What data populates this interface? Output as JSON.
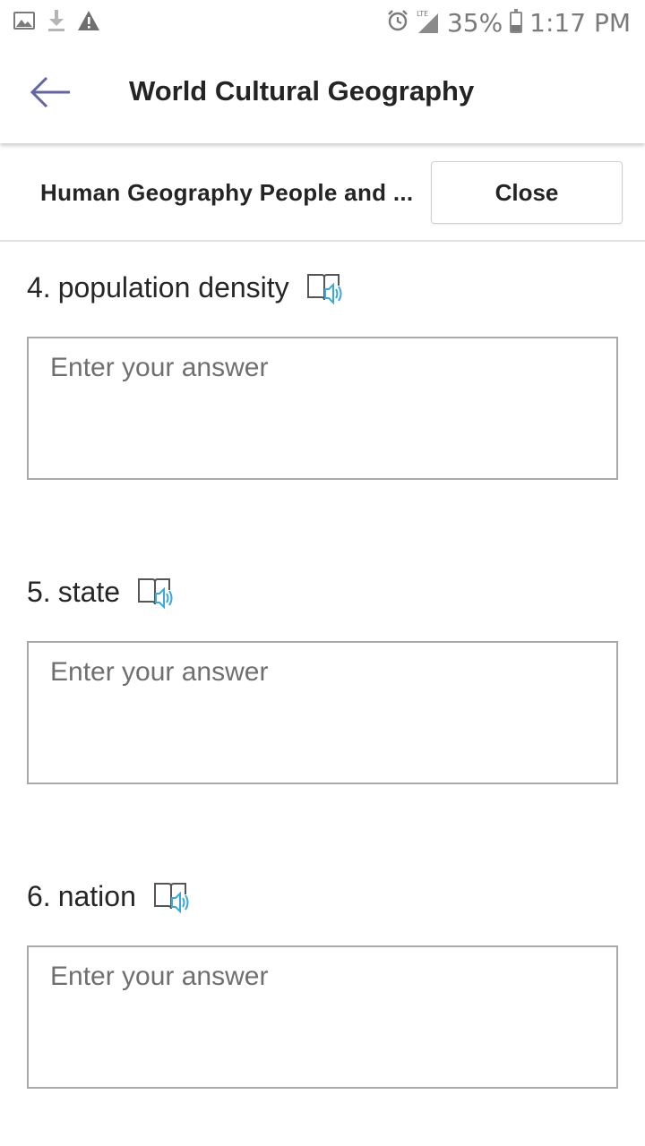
{
  "status_bar": {
    "battery": "35%",
    "battery_level": 0.35,
    "time": "1:17 PM",
    "network": "LTE",
    "icons_left": [
      "image-icon",
      "download-icon",
      "warning-icon"
    ],
    "icons_right": [
      "alarm-icon",
      "signal-icon",
      "battery-icon"
    ]
  },
  "app_bar": {
    "title": "World Cultural Geography",
    "back_icon": "back-arrow-icon",
    "accent_color": "#6264a7"
  },
  "sub_header": {
    "form_name": "Human Geography People and ...",
    "close_label": "Close"
  },
  "questions": [
    {
      "number": "4.",
      "title": "population density",
      "placeholder": "Enter your answer",
      "reader_icon": "immersive-reader-icon"
    },
    {
      "number": "5.",
      "title": "state",
      "placeholder": "Enter your answer",
      "reader_icon": "immersive-reader-icon"
    },
    {
      "number": "6.",
      "title": "nation",
      "placeholder": "Enter your answer",
      "reader_icon": "immersive-reader-icon"
    }
  ],
  "colors": {
    "reader_icon_accent": "#3aa8d8",
    "border": "#a9a9a9"
  }
}
